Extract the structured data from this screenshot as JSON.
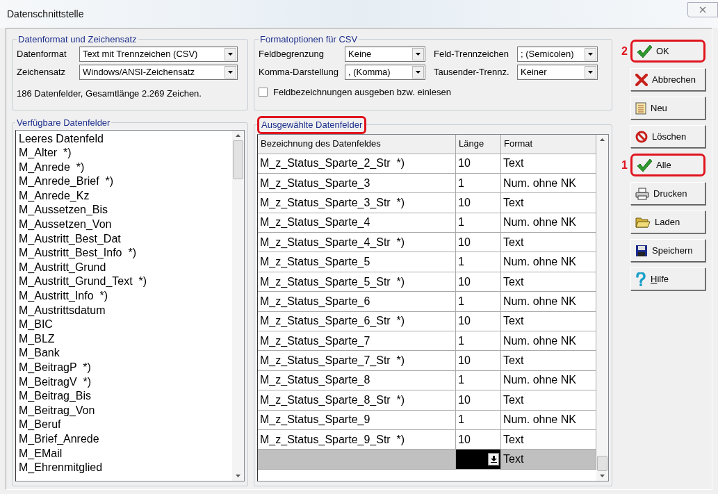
{
  "window": {
    "title": "Datenschnittstelle"
  },
  "format_group": {
    "title": "Datenformat und Zeichensatz",
    "fields": [
      {
        "label": "Datenformat",
        "value": "Text mit Trennzeichen (CSV)"
      },
      {
        "label": "Zeichensatz",
        "value": "Windows/ANSI-Zeichensatz"
      }
    ],
    "summary": "186 Datenfelder, Gesamtlänge 2.269 Zeichen."
  },
  "csv_group": {
    "title": "Formatoptionen für CSV",
    "fields": [
      {
        "label": "Feldbegrenzung",
        "value": "Keine"
      },
      {
        "label": "Feld-Trennzeichen",
        "value": "; (Semicolen)"
      },
      {
        "label": "Komma-Darstellung",
        "value": ", (Komma)"
      },
      {
        "label": "Tausender-Trennz.",
        "value": "Keiner"
      }
    ],
    "checkbox": {
      "label": "Feldbezeichnungen ausgeben bzw. einlesen",
      "checked": false
    }
  },
  "available_fields": {
    "title": "Verfügbare Datenfelder",
    "items": [
      "Leeres Datenfeld",
      "M_Alter  *)",
      "M_Anrede  *)",
      "M_Anrede_Brief  *)",
      "M_Anrede_Kz",
      "M_Aussetzen_Bis",
      "M_Aussetzen_Von",
      "M_Austritt_Best_Dat",
      "M_Austritt_Best_Info  *)",
      "M_Austritt_Grund",
      "M_Austritt_Grund_Text  *)",
      "M_Austritt_Info  *)",
      "M_Austrittsdatum",
      "M_BIC",
      "M_BLZ",
      "M_Bank",
      "M_BeitragP  *)",
      "M_BeitragV  *)",
      "M_Beitrag_Bis",
      "M_Beitrag_Von",
      "M_Beruf",
      "M_Brief_Anrede",
      "M_EMail",
      "M_Ehrenmitglied"
    ]
  },
  "selected_fields": {
    "title": "Ausgewählte Datenfelder",
    "highlighted": true,
    "columns": [
      "Bezeichnung des Datenfeldes",
      "Länge",
      "Format"
    ],
    "rows": [
      {
        "name": "M_z_Status_Sparte_2_Str  *)",
        "length": "10",
        "format": "Text",
        "selected": false
      },
      {
        "name": "M_z_Status_Sparte_3",
        "length": "1",
        "format": "Num. ohne NK",
        "selected": false
      },
      {
        "name": "M_z_Status_Sparte_3_Str  *)",
        "length": "10",
        "format": "Text",
        "selected": false
      },
      {
        "name": "M_z_Status_Sparte_4",
        "length": "1",
        "format": "Num. ohne NK",
        "selected": false
      },
      {
        "name": "M_z_Status_Sparte_4_Str  *)",
        "length": "10",
        "format": "Text",
        "selected": false
      },
      {
        "name": "M_z_Status_Sparte_5",
        "length": "1",
        "format": "Num. ohne NK",
        "selected": false
      },
      {
        "name": "M_z_Status_Sparte_5_Str  *)",
        "length": "10",
        "format": "Text",
        "selected": false
      },
      {
        "name": "M_z_Status_Sparte_6",
        "length": "1",
        "format": "Num. ohne NK",
        "selected": false
      },
      {
        "name": "M_z_Status_Sparte_6_Str  *)",
        "length": "10",
        "format": "Text",
        "selected": false
      },
      {
        "name": "M_z_Status_Sparte_7",
        "length": "1",
        "format": "Num. ohne NK",
        "selected": false
      },
      {
        "name": "M_z_Status_Sparte_7_Str  *)",
        "length": "10",
        "format": "Text",
        "selected": false
      },
      {
        "name": "M_z_Status_Sparte_8",
        "length": "1",
        "format": "Num. ohne NK",
        "selected": false
      },
      {
        "name": "M_z_Status_Sparte_8_Str  *)",
        "length": "10",
        "format": "Text",
        "selected": false
      },
      {
        "name": "M_z_Status_Sparte_9",
        "length": "1",
        "format": "Num. ohne NK",
        "selected": false
      },
      {
        "name": "M_z_Status_Sparte_9_Str  *)",
        "length": "10",
        "format": "Text",
        "selected": false
      },
      {
        "format": "Text",
        "selected": true
      }
    ]
  },
  "buttons": [
    {
      "kind": "ok",
      "label": "OK",
      "highlighted": true,
      "callout": "2"
    },
    {
      "kind": "cancel",
      "label": "Abbrechen",
      "highlighted": false
    },
    {
      "kind": "new",
      "label": "Neu",
      "highlighted": false
    },
    {
      "kind": "delete",
      "label": "Löschen",
      "highlighted": false
    },
    {
      "kind": "all",
      "label": "Alle",
      "highlighted": true,
      "callout": "1"
    },
    {
      "kind": "print",
      "label": "Drucken",
      "highlighted": false
    },
    {
      "kind": "load",
      "label": "Laden",
      "highlighted": false
    },
    {
      "kind": "save",
      "label": "Speichern",
      "highlighted": false
    },
    {
      "kind": "help",
      "label": "Hilfe",
      "highlighted": false,
      "underline_first": true
    }
  ]
}
